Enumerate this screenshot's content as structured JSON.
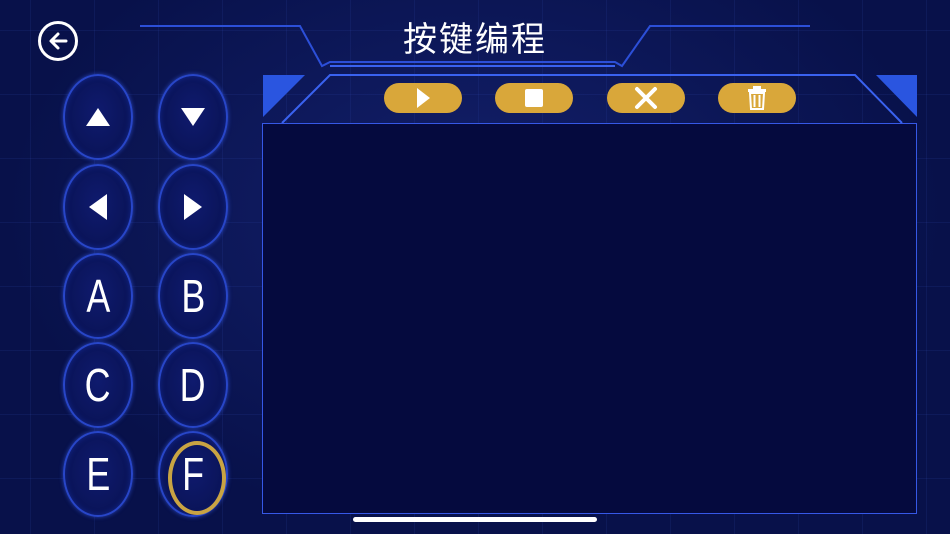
{
  "header": {
    "title": "按键编程",
    "back_icon": "arrow-left-circle-icon"
  },
  "keypad": {
    "keys": [
      {
        "id": "up",
        "label": "",
        "icon": "triangle-up-icon"
      },
      {
        "id": "down",
        "label": "",
        "icon": "triangle-down-icon"
      },
      {
        "id": "left",
        "label": "",
        "icon": "triangle-left-icon"
      },
      {
        "id": "right",
        "label": "",
        "icon": "triangle-right-icon"
      },
      {
        "id": "a",
        "label": "A"
      },
      {
        "id": "b",
        "label": "B"
      },
      {
        "id": "c",
        "label": "C"
      },
      {
        "id": "d",
        "label": "D"
      },
      {
        "id": "e",
        "label": "E"
      },
      {
        "id": "f",
        "label": "F",
        "selected": true
      }
    ]
  },
  "toolbar": {
    "buttons": [
      {
        "id": "play",
        "icon": "play-icon"
      },
      {
        "id": "stop",
        "icon": "stop-icon"
      },
      {
        "id": "clear",
        "icon": "close-icon"
      },
      {
        "id": "delete",
        "icon": "trash-icon"
      }
    ]
  },
  "colors": {
    "background": "#08114a",
    "accent_blue": "#2846c8",
    "button_gold": "#d9a73a",
    "selected_ring": "#c9a443",
    "text": "#ffffff"
  }
}
